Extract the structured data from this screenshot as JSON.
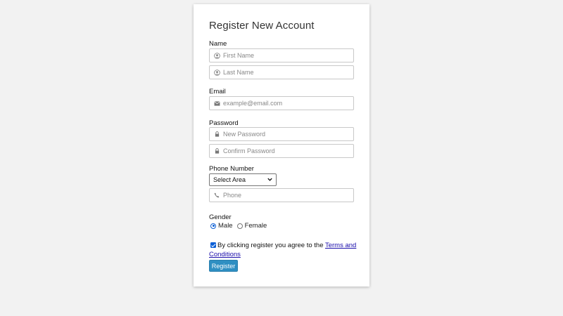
{
  "form": {
    "title": "Register New Account",
    "name_label": "Name",
    "first_name_placeholder": "First Name",
    "last_name_placeholder": "Last Name",
    "email_label": "Email",
    "email_placeholder": "example@email.com",
    "password_label": "Password",
    "new_password_placeholder": "New Password",
    "confirm_password_placeholder": "Confirm Password",
    "phone_label": "Phone Number",
    "area_select_value": "Select Area",
    "phone_placeholder": "Phone",
    "gender_label": "Gender",
    "gender_options": [
      "Male",
      "Female"
    ],
    "gender_selected": "Male",
    "terms_checked": true,
    "terms_text": "By clicking register you agree to the ",
    "terms_link": "Terms and Conditions",
    "register_button": "Register"
  },
  "icons": {
    "first_name": "user-icon",
    "last_name": "user-icon",
    "email": "envelope-icon",
    "new_password": "lock-icon",
    "confirm_password": "lock-icon",
    "phone": "phone-icon",
    "select": "chevron-down-icon"
  },
  "colors": {
    "button_bg": "#2f8fc2",
    "link": "#1a0dab",
    "accent": "#0b5fd6"
  }
}
